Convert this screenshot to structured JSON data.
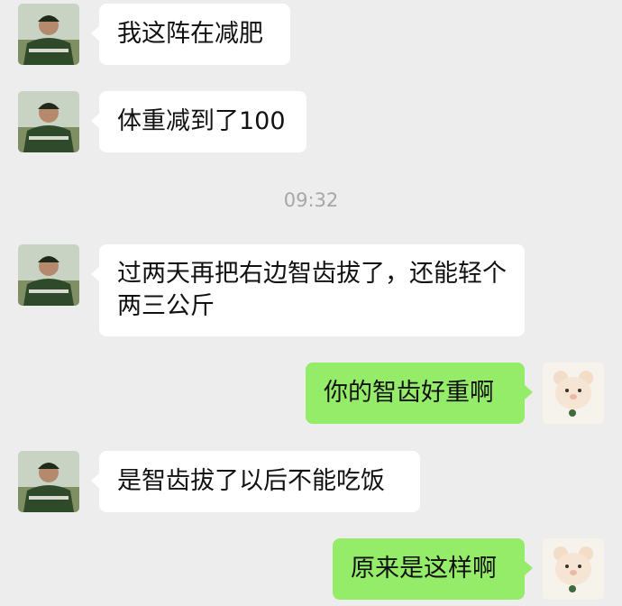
{
  "chat": {
    "messages": [
      {
        "side": "in",
        "text": "我这阵在减肥",
        "avatar": "soldier-avatar"
      },
      {
        "side": "in",
        "text": "体重减到了100",
        "avatar": "soldier-avatar"
      },
      {
        "side": "in",
        "text": "过两天再把右边智齿拔了，还能轻个两三公斤",
        "avatar": "soldier-avatar"
      },
      {
        "side": "out",
        "text": "你的智齿好重啊",
        "avatar": "bear-avatar"
      },
      {
        "side": "in",
        "text": "是智齿拔了以后不能吃饭",
        "avatar": "soldier-avatar"
      },
      {
        "side": "out",
        "text": "原来是这样啊",
        "avatar": "bear-avatar"
      }
    ],
    "timestamp": "09:32"
  },
  "colors": {
    "background": "#ededed",
    "incoming_bubble": "#ffffff",
    "outgoing_bubble": "#95ec69",
    "timestamp_text": "#a7a7a7"
  }
}
